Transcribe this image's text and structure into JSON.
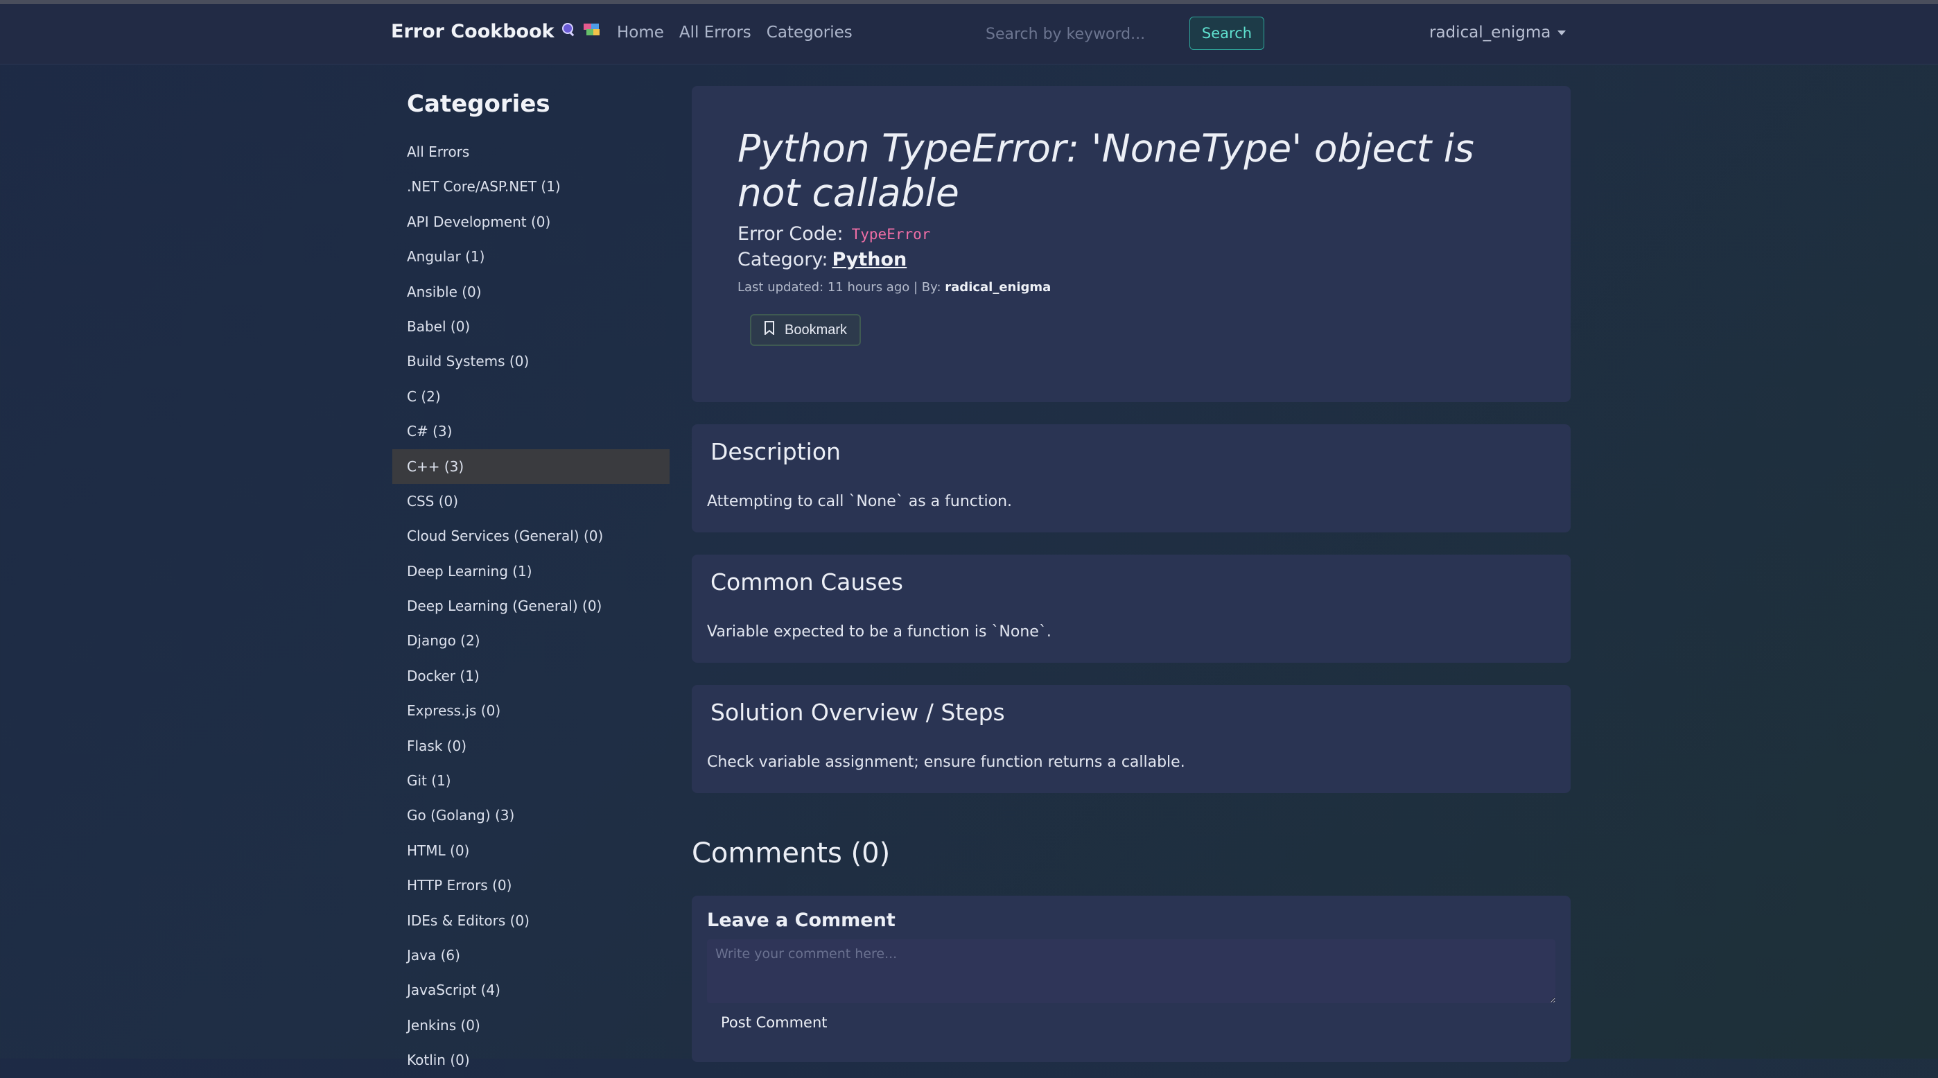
{
  "navbar": {
    "brand": "Error Cookbook",
    "brand_icons": [
      "magnifier-icon",
      "colorful-blocks-icon"
    ],
    "links": [
      "Home",
      "All Errors",
      "Categories"
    ],
    "search_placeholder": "Search by keyword...",
    "search_label": "Search",
    "username": "radical_enigma"
  },
  "sidebar": {
    "title": "Categories",
    "items": [
      "All Errors",
      ".NET Core/ASP.NET (1)",
      "API Development (0)",
      "Angular (1)",
      "Ansible (0)",
      "Babel (0)",
      "Build Systems (0)",
      "C (2)",
      "C# (3)",
      "C++ (3)",
      "CSS (0)",
      "Cloud Services (General) (0)",
      "Deep Learning (1)",
      "Deep Learning (General) (0)",
      "Django (2)",
      "Docker (1)",
      "Express.js (0)",
      "Flask (0)",
      "Git (1)",
      "Go (Golang) (3)",
      "HTML (0)",
      "HTTP Errors (0)",
      "IDEs & Editors (0)",
      "Java (6)",
      "JavaScript (4)",
      "Jenkins (0)",
      "Kotlin (0)"
    ],
    "active_index": 9
  },
  "error": {
    "title": "Python TypeError: 'NoneType' object is not callable",
    "code_label": "Error Code:",
    "code": "TypeError",
    "category_label": "Category:",
    "category": "Python",
    "updated_prefix": "Last updated: 11 hours ago | By:",
    "author": "radical_enigma",
    "bookmark_label": "Bookmark"
  },
  "sections": {
    "description": {
      "title": "Description",
      "body": "Attempting to call `None` as a function."
    },
    "causes": {
      "title": "Common Causes",
      "body": "Variable expected to be a function is `None`."
    },
    "solution": {
      "title": "Solution Overview / Steps",
      "body": "Check variable assignment; ensure function returns a callable."
    }
  },
  "comments": {
    "heading": "Comments (0)",
    "form_title": "Leave a Comment",
    "placeholder": "Write your comment here...",
    "submit_label": "Post Comment"
  },
  "colors": {
    "background": "#1f2b44",
    "card": "#2a3453",
    "accent": "#2fa69a",
    "code": "#f06ea6"
  }
}
